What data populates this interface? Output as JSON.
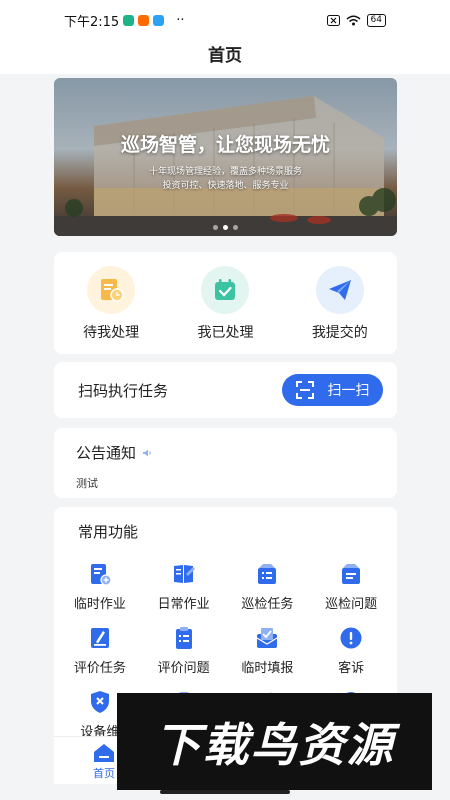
{
  "status_bar": {
    "time": "下午2:15",
    "app_icon_colors": [
      "#1fb389",
      "#ff6a00",
      "#2ea1f2"
    ],
    "more": "··",
    "battery": "64"
  },
  "nav": {
    "title": "首页"
  },
  "banner": {
    "title": "巡场智管，让您现场无忧",
    "subtitle_line1": "十年现场管理经验，覆盖多种场景服务",
    "subtitle_line2": "投资可控、快速落地、服务专业",
    "slide_count": 3,
    "active_slide": 2
  },
  "quick_actions": [
    {
      "label": "待我处理",
      "icon": "pending-doc-icon",
      "bg": "#fff3dd",
      "color": "#f6b94a"
    },
    {
      "label": "我已处理",
      "icon": "calendar-check-icon",
      "bg": "#e3f5f1",
      "color": "#3cc3a3"
    },
    {
      "label": "我提交的",
      "icon": "paper-plane-icon",
      "bg": "#e6f0fd",
      "color": "#2f6bea"
    }
  ],
  "scan": {
    "label": "扫码执行任务",
    "button_label": "扫一扫"
  },
  "notice": {
    "title": "公告通知",
    "text": "测试"
  },
  "features": {
    "title": "常用功能",
    "items": [
      {
        "label": "临时作业",
        "icon": "temp-job-icon"
      },
      {
        "label": "日常作业",
        "icon": "daily-job-icon"
      },
      {
        "label": "巡检任务",
        "icon": "inspection-task-icon"
      },
      {
        "label": "巡检问题",
        "icon": "inspection-issue-icon"
      },
      {
        "label": "评价任务",
        "icon": "evaluation-task-icon"
      },
      {
        "label": "评价问题",
        "icon": "evaluation-issue-icon"
      },
      {
        "label": "临时填报",
        "icon": "temp-report-icon"
      },
      {
        "label": "客诉",
        "icon": "complaint-icon"
      },
      {
        "label": "设备维",
        "icon": "device-maintenance-icon"
      },
      {
        "label": "",
        "icon": "box-icon"
      },
      {
        "label": "",
        "icon": "tools-icon"
      },
      {
        "label": "",
        "icon": "settings-icon"
      }
    ]
  },
  "tabbar": {
    "home_label": "首页"
  },
  "watermark": {
    "text": "下载鸟资源"
  },
  "colors": {
    "primary": "#2f6bea",
    "background": "#f3f4f6"
  }
}
